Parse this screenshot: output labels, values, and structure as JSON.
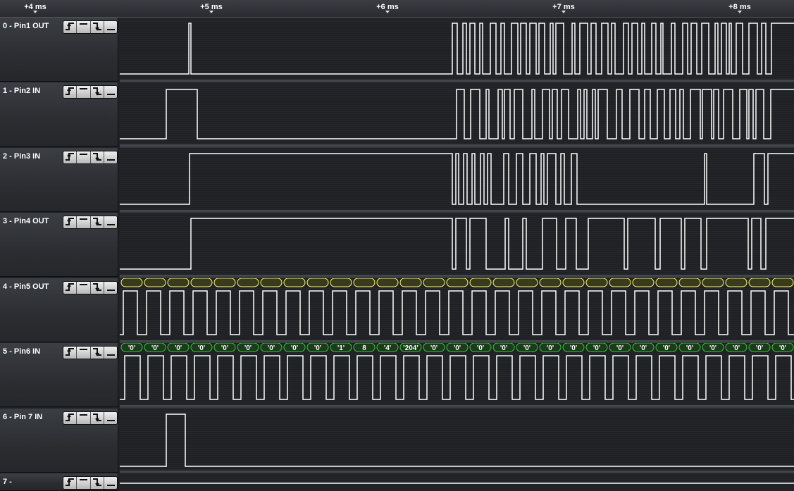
{
  "ruler": {
    "ticks": [
      "+4 ms",
      "+5 ms",
      "+6 ms",
      "+7 ms",
      "+8 ms"
    ]
  },
  "channels": [
    {
      "label": "0 - Pin1 OUT"
    },
    {
      "label": "1 - Pin2 IN"
    },
    {
      "label": "2 - Pin3 IN"
    },
    {
      "label": "3 - Pin4 OUT"
    },
    {
      "label": "4 - Pin5 OUT"
    },
    {
      "label": "5 - Pin6 IN"
    },
    {
      "label": "6 - Pin 7 IN"
    },
    {
      "label": "7 -"
    }
  ],
  "trigger_buttons": [
    "rising-edge-icon",
    "high-level-icon",
    "falling-edge-icon",
    "low-level-icon"
  ],
  "decoded_bytes": [
    "'0'",
    "'0'",
    "'0'",
    "'0'",
    "'0'",
    "'0'",
    "'0'",
    "'0'",
    "'0'",
    "'1'",
    "8",
    "'4'",
    "'204'",
    "'0'",
    "'0'",
    "'0'",
    "'0'",
    "'0'",
    "'0'",
    "'0'",
    "'0'",
    "'0'",
    "'0'",
    "'0'",
    "'0'",
    "'0'",
    "'0'",
    "'0'",
    "'0'"
  ],
  "colors": {
    "background": "#202226",
    "signal": "#ffffff",
    "clock_bubble": "#ffff66",
    "data_bubble": "#33cc33"
  }
}
